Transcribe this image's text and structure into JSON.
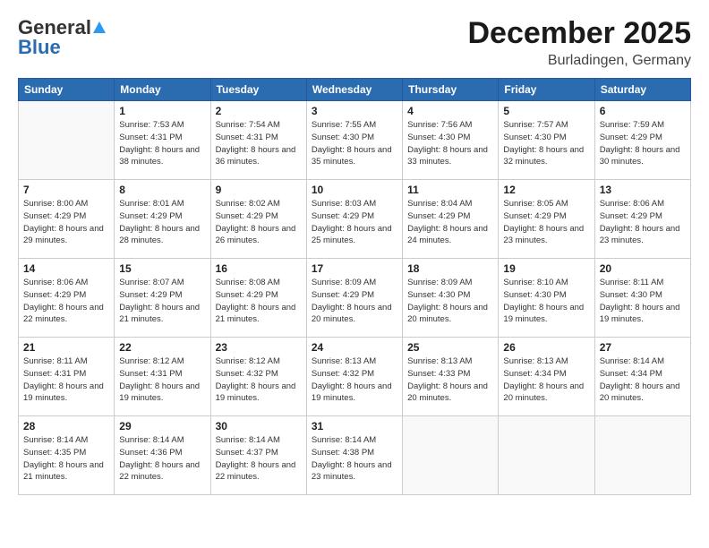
{
  "logo": {
    "general": "General",
    "blue": "Blue"
  },
  "title": "December 2025",
  "location": "Burladingen, Germany",
  "weekdays": [
    "Sunday",
    "Monday",
    "Tuesday",
    "Wednesday",
    "Thursday",
    "Friday",
    "Saturday"
  ],
  "weeks": [
    [
      {
        "day": "",
        "sunrise": "",
        "sunset": "",
        "daylight": ""
      },
      {
        "day": "1",
        "sunrise": "Sunrise: 7:53 AM",
        "sunset": "Sunset: 4:31 PM",
        "daylight": "Daylight: 8 hours and 38 minutes."
      },
      {
        "day": "2",
        "sunrise": "Sunrise: 7:54 AM",
        "sunset": "Sunset: 4:31 PM",
        "daylight": "Daylight: 8 hours and 36 minutes."
      },
      {
        "day": "3",
        "sunrise": "Sunrise: 7:55 AM",
        "sunset": "Sunset: 4:30 PM",
        "daylight": "Daylight: 8 hours and 35 minutes."
      },
      {
        "day": "4",
        "sunrise": "Sunrise: 7:56 AM",
        "sunset": "Sunset: 4:30 PM",
        "daylight": "Daylight: 8 hours and 33 minutes."
      },
      {
        "day": "5",
        "sunrise": "Sunrise: 7:57 AM",
        "sunset": "Sunset: 4:30 PM",
        "daylight": "Daylight: 8 hours and 32 minutes."
      },
      {
        "day": "6",
        "sunrise": "Sunrise: 7:59 AM",
        "sunset": "Sunset: 4:29 PM",
        "daylight": "Daylight: 8 hours and 30 minutes."
      }
    ],
    [
      {
        "day": "7",
        "sunrise": "Sunrise: 8:00 AM",
        "sunset": "Sunset: 4:29 PM",
        "daylight": "Daylight: 8 hours and 29 minutes."
      },
      {
        "day": "8",
        "sunrise": "Sunrise: 8:01 AM",
        "sunset": "Sunset: 4:29 PM",
        "daylight": "Daylight: 8 hours and 28 minutes."
      },
      {
        "day": "9",
        "sunrise": "Sunrise: 8:02 AM",
        "sunset": "Sunset: 4:29 PM",
        "daylight": "Daylight: 8 hours and 26 minutes."
      },
      {
        "day": "10",
        "sunrise": "Sunrise: 8:03 AM",
        "sunset": "Sunset: 4:29 PM",
        "daylight": "Daylight: 8 hours and 25 minutes."
      },
      {
        "day": "11",
        "sunrise": "Sunrise: 8:04 AM",
        "sunset": "Sunset: 4:29 PM",
        "daylight": "Daylight: 8 hours and 24 minutes."
      },
      {
        "day": "12",
        "sunrise": "Sunrise: 8:05 AM",
        "sunset": "Sunset: 4:29 PM",
        "daylight": "Daylight: 8 hours and 23 minutes."
      },
      {
        "day": "13",
        "sunrise": "Sunrise: 8:06 AM",
        "sunset": "Sunset: 4:29 PM",
        "daylight": "Daylight: 8 hours and 23 minutes."
      }
    ],
    [
      {
        "day": "14",
        "sunrise": "Sunrise: 8:06 AM",
        "sunset": "Sunset: 4:29 PM",
        "daylight": "Daylight: 8 hours and 22 minutes."
      },
      {
        "day": "15",
        "sunrise": "Sunrise: 8:07 AM",
        "sunset": "Sunset: 4:29 PM",
        "daylight": "Daylight: 8 hours and 21 minutes."
      },
      {
        "day": "16",
        "sunrise": "Sunrise: 8:08 AM",
        "sunset": "Sunset: 4:29 PM",
        "daylight": "Daylight: 8 hours and 21 minutes."
      },
      {
        "day": "17",
        "sunrise": "Sunrise: 8:09 AM",
        "sunset": "Sunset: 4:29 PM",
        "daylight": "Daylight: 8 hours and 20 minutes."
      },
      {
        "day": "18",
        "sunrise": "Sunrise: 8:09 AM",
        "sunset": "Sunset: 4:30 PM",
        "daylight": "Daylight: 8 hours and 20 minutes."
      },
      {
        "day": "19",
        "sunrise": "Sunrise: 8:10 AM",
        "sunset": "Sunset: 4:30 PM",
        "daylight": "Daylight: 8 hours and 19 minutes."
      },
      {
        "day": "20",
        "sunrise": "Sunrise: 8:11 AM",
        "sunset": "Sunset: 4:30 PM",
        "daylight": "Daylight: 8 hours and 19 minutes."
      }
    ],
    [
      {
        "day": "21",
        "sunrise": "Sunrise: 8:11 AM",
        "sunset": "Sunset: 4:31 PM",
        "daylight": "Daylight: 8 hours and 19 minutes."
      },
      {
        "day": "22",
        "sunrise": "Sunrise: 8:12 AM",
        "sunset": "Sunset: 4:31 PM",
        "daylight": "Daylight: 8 hours and 19 minutes."
      },
      {
        "day": "23",
        "sunrise": "Sunrise: 8:12 AM",
        "sunset": "Sunset: 4:32 PM",
        "daylight": "Daylight: 8 hours and 19 minutes."
      },
      {
        "day": "24",
        "sunrise": "Sunrise: 8:13 AM",
        "sunset": "Sunset: 4:32 PM",
        "daylight": "Daylight: 8 hours and 19 minutes."
      },
      {
        "day": "25",
        "sunrise": "Sunrise: 8:13 AM",
        "sunset": "Sunset: 4:33 PM",
        "daylight": "Daylight: 8 hours and 20 minutes."
      },
      {
        "day": "26",
        "sunrise": "Sunrise: 8:13 AM",
        "sunset": "Sunset: 4:34 PM",
        "daylight": "Daylight: 8 hours and 20 minutes."
      },
      {
        "day": "27",
        "sunrise": "Sunrise: 8:14 AM",
        "sunset": "Sunset: 4:34 PM",
        "daylight": "Daylight: 8 hours and 20 minutes."
      }
    ],
    [
      {
        "day": "28",
        "sunrise": "Sunrise: 8:14 AM",
        "sunset": "Sunset: 4:35 PM",
        "daylight": "Daylight: 8 hours and 21 minutes."
      },
      {
        "day": "29",
        "sunrise": "Sunrise: 8:14 AM",
        "sunset": "Sunset: 4:36 PM",
        "daylight": "Daylight: 8 hours and 22 minutes."
      },
      {
        "day": "30",
        "sunrise": "Sunrise: 8:14 AM",
        "sunset": "Sunset: 4:37 PM",
        "daylight": "Daylight: 8 hours and 22 minutes."
      },
      {
        "day": "31",
        "sunrise": "Sunrise: 8:14 AM",
        "sunset": "Sunset: 4:38 PM",
        "daylight": "Daylight: 8 hours and 23 minutes."
      },
      {
        "day": "",
        "sunrise": "",
        "sunset": "",
        "daylight": ""
      },
      {
        "day": "",
        "sunrise": "",
        "sunset": "",
        "daylight": ""
      },
      {
        "day": "",
        "sunrise": "",
        "sunset": "",
        "daylight": ""
      }
    ]
  ]
}
